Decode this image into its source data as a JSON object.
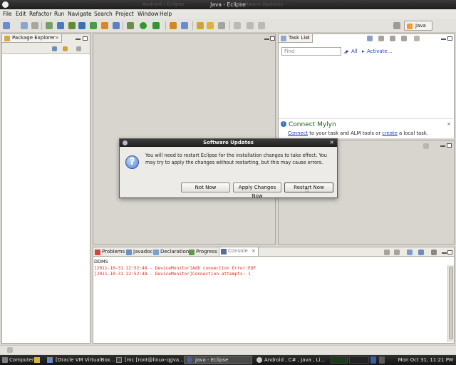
{
  "window": {
    "title": "Java - Eclipse",
    "ghost_left": "Android / Eclipse",
    "ghost_right": "Software Updates"
  },
  "menu": [
    "File",
    "Edit",
    "Refactor",
    "Run",
    "Navigate",
    "Search",
    "Project",
    "Window",
    "Help"
  ],
  "perspective": {
    "label": "Java"
  },
  "package_explorer": {
    "title": "Package Explorer"
  },
  "task_list": {
    "title": "Task List",
    "find_placeholder": "Find",
    "all_label": "All",
    "activate_label": "Activate..."
  },
  "mylyn": {
    "title": "Connect Mylyn",
    "link_connect": "Connect",
    "mid_text": "to your task and ALM tools or",
    "link_create": "create",
    "end_text": "a local task."
  },
  "console": {
    "tabs": [
      "Problems",
      "Javadoc",
      "Declaration",
      "Progress",
      "Console"
    ],
    "source": "DDMS",
    "lines": [
      "[2011-10-31 22:52:48 - DeviceMonitor]Adb connection Error:EOF",
      "[2011-10-31 22:52:48 - DeviceMonitor]Connection attempts: 1"
    ]
  },
  "dialog": {
    "title": "Software Updates",
    "message": "You will need to restart Eclipse for the installation changes to take effect. You may try to apply the changes without restarting, but this may cause errors.",
    "buttons": {
      "not_now": "Not Now",
      "apply": "Apply Changes Now",
      "restart": "Restart Now"
    }
  },
  "taskbar": {
    "computer": "Computer",
    "items": [
      "[Oracle VM VirtualBox...",
      "[mc [root@linux-qgva...",
      "Java - Eclipse",
      "Android , C# , Java , Li..."
    ],
    "clock": "Mon Oct 31, 11:21 PM"
  },
  "colors": {
    "mylyn_title": "#1c5a12",
    "log_error": "#d7301f",
    "link": "#1e3bb5",
    "perspective_icon": "#f09a3c"
  }
}
